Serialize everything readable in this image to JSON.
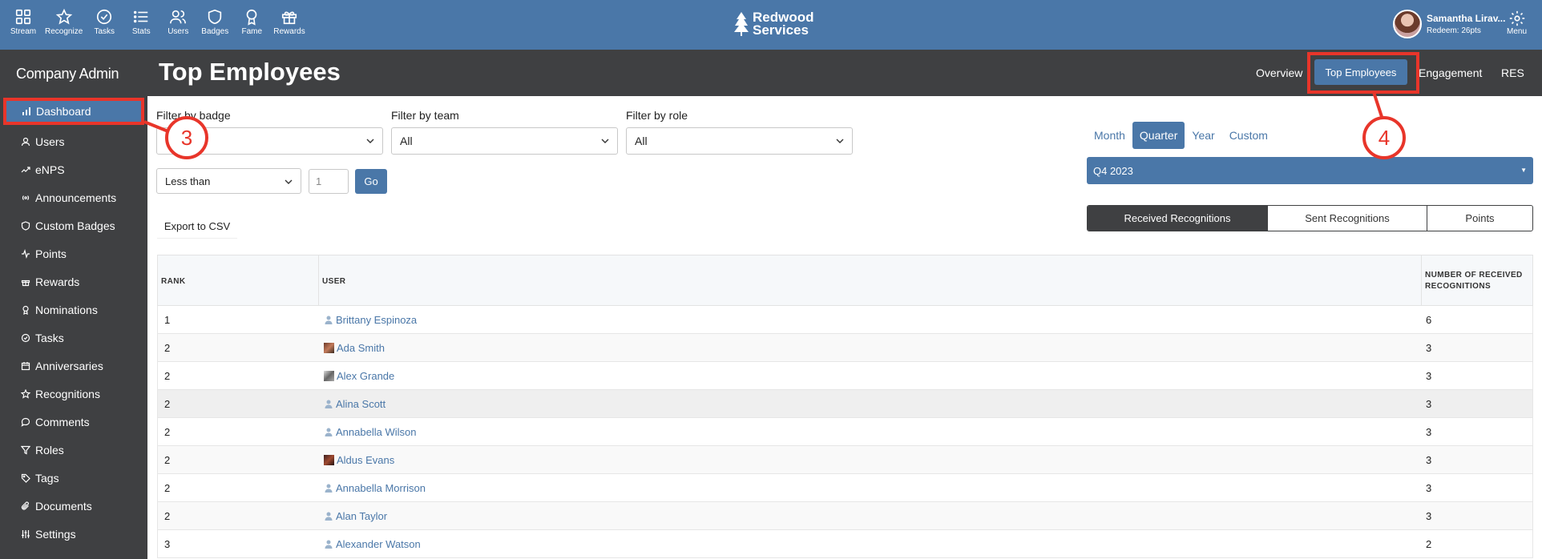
{
  "topnav": {
    "items": [
      {
        "label": "Stream",
        "icon": "grid-icon"
      },
      {
        "label": "Recognize",
        "icon": "star-icon"
      },
      {
        "label": "Tasks",
        "icon": "check-circle-icon"
      },
      {
        "label": "Stats",
        "icon": "list-icon"
      },
      {
        "label": "Users",
        "icon": "users-icon"
      },
      {
        "label": "Badges",
        "icon": "shield-icon"
      },
      {
        "label": "Fame",
        "icon": "award-icon"
      },
      {
        "label": "Rewards",
        "icon": "gift-icon"
      }
    ],
    "brand_line1": "Redwood",
    "brand_line2": "Services",
    "user_name": "Samantha Lirav...",
    "user_redeem": "Redeem: 26pts",
    "menu_label": "Menu"
  },
  "sidebar": {
    "title": "Company Admin",
    "items": [
      {
        "label": "Dashboard",
        "icon": "bar-chart-icon"
      },
      {
        "label": "Users",
        "icon": "user-icon"
      },
      {
        "label": "eNPS",
        "icon": "trend-icon"
      },
      {
        "label": "Announcements",
        "icon": "broadcast-icon"
      },
      {
        "label": "Custom Badges",
        "icon": "shield-icon"
      },
      {
        "label": "Points",
        "icon": "activity-icon"
      },
      {
        "label": "Rewards",
        "icon": "gift-icon"
      },
      {
        "label": "Nominations",
        "icon": "award-icon"
      },
      {
        "label": "Tasks",
        "icon": "check-circle-icon"
      },
      {
        "label": "Anniversaries",
        "icon": "calendar-icon"
      },
      {
        "label": "Recognitions",
        "icon": "star-icon"
      },
      {
        "label": "Comments",
        "icon": "comment-icon"
      },
      {
        "label": "Roles",
        "icon": "filter-icon"
      },
      {
        "label": "Tags",
        "icon": "tag-icon"
      },
      {
        "label": "Documents",
        "icon": "paperclip-icon"
      },
      {
        "label": "Settings",
        "icon": "sliders-icon"
      }
    ]
  },
  "header": {
    "title": "Top Employees",
    "tabs": [
      "Overview",
      "Top Employees",
      "Engagement",
      "RES"
    ],
    "active_tab": "Top Employees"
  },
  "filters": {
    "badge_label": "Filter by badge",
    "badge_value": "",
    "team_label": "Filter by team",
    "team_value": "All",
    "role_label": "Filter by role",
    "role_value": "All",
    "comparison_value": "Less than",
    "count_placeholder": "1",
    "go_label": "Go",
    "export_label": "Export to CSV"
  },
  "period": {
    "tabs": [
      "Month",
      "Quarter",
      "Year",
      "Custom"
    ],
    "active": "Quarter",
    "selected": "Q4 2023"
  },
  "segments": {
    "items": [
      "Received Recognitions",
      "Sent Recognitions",
      "Points"
    ],
    "active": "Received Recognitions"
  },
  "table": {
    "headers": {
      "rank": "RANK",
      "user": "USER",
      "count_line1": "NUMBER OF RECEIVED",
      "count_line2": "RECOGNITIONS"
    },
    "rows": [
      {
        "rank": "1",
        "user": "Brittany Espinoza",
        "count": "6",
        "avatar": "placeholder"
      },
      {
        "rank": "2",
        "user": "Ada Smith",
        "count": "3",
        "avatar": "photo"
      },
      {
        "rank": "2",
        "user": "Alex Grande",
        "count": "3",
        "avatar": "photo-bw"
      },
      {
        "rank": "2",
        "user": "Alina Scott",
        "count": "3",
        "avatar": "placeholder"
      },
      {
        "rank": "2",
        "user": "Annabella Wilson",
        "count": "3",
        "avatar": "placeholder"
      },
      {
        "rank": "2",
        "user": "Aldus Evans",
        "count": "3",
        "avatar": "photo"
      },
      {
        "rank": "2",
        "user": "Annabella Morrison",
        "count": "3",
        "avatar": "placeholder"
      },
      {
        "rank": "2",
        "user": "Alan Taylor",
        "count": "3",
        "avatar": "placeholder"
      },
      {
        "rank": "3",
        "user": "Alexander Watson",
        "count": "2",
        "avatar": "placeholder"
      }
    ]
  },
  "callouts": {
    "step3": "3",
    "step4": "4"
  },
  "colors": {
    "accent": "#4a77a8",
    "dark": "#3f4042",
    "callout": "#e8352a"
  }
}
